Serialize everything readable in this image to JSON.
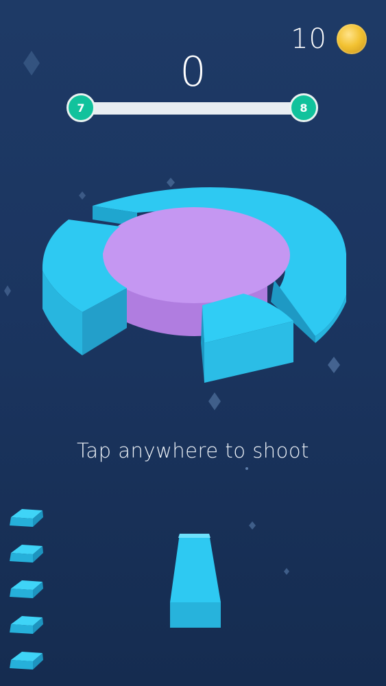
{
  "hud": {
    "coin_count": "10",
    "score": "0",
    "level_current": "7",
    "level_next": "8",
    "level_progress": 0.0
  },
  "hint_text": "Tap anywhere to shoot",
  "remaining_shots": 5,
  "colors": {
    "background": "#1b3560",
    "ring": "#2ec9f2",
    "core": "#b98ae8",
    "level_bubble": "#11c29c",
    "coin": "#f2c232"
  }
}
